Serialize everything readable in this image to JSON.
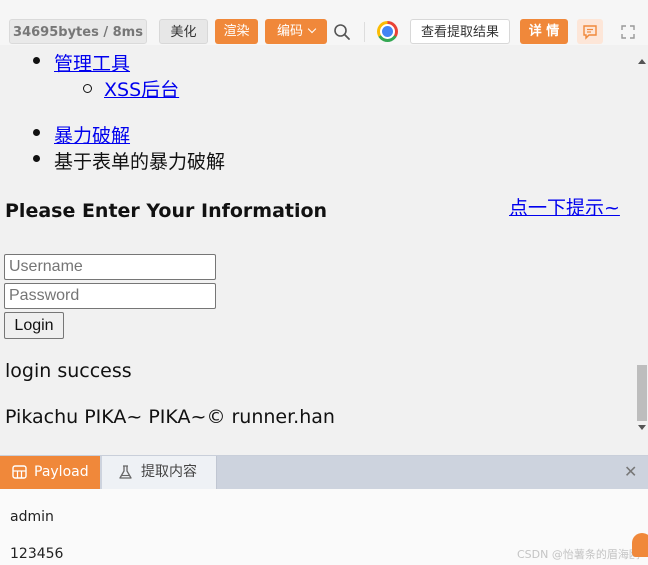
{
  "toolbar": {
    "stats": "34695bytes / 8ms",
    "beautify_label": "美化",
    "render_label": "渲染",
    "encode_label": "编码",
    "extract_result_label": "查看提取结果",
    "details_label": "详 情",
    "icons": [
      "search-icon",
      "chrome-icon",
      "chat-icon",
      "expand-icon"
    ]
  },
  "page": {
    "nav": {
      "manage_tools": "管理工具",
      "xss_backend": "XSS后台",
      "brute_force": "暴力破解",
      "brute_force_sub": "基于表单的暴力破解"
    },
    "hint_link": "点一下提示~",
    "heading": "Please Enter Your Information",
    "form": {
      "username_placeholder": "Username",
      "password_placeholder": "Password",
      "login_label": "Login"
    },
    "result": "login success",
    "footer": "Pikachu PIKA~ PIKA~© runner.han"
  },
  "panel": {
    "tabs": [
      {
        "label": "Payload",
        "active": true
      },
      {
        "label": "提取内容",
        "active": false
      }
    ],
    "lines": [
      "admin",
      "123456"
    ],
    "watermark": "CSDN @怡薯条的眉海鸥"
  },
  "colors": {
    "accent": "#f0883a",
    "link": "#0000ee",
    "page_bg": "#f1f1f1",
    "tabbar_bg": "#cdd3de"
  }
}
